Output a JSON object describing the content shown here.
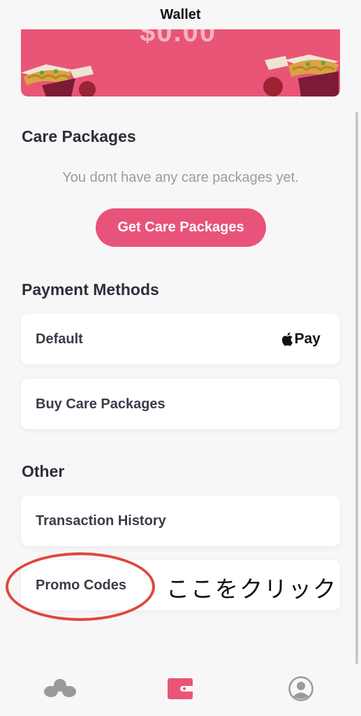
{
  "header": {
    "title": "Wallet"
  },
  "promo_card": {
    "partial_amount": "$0.00",
    "brand_color": "#e85577"
  },
  "care_packages": {
    "title": "Care Packages",
    "empty_message": "You dont have any care packages yet.",
    "cta_label": "Get Care Packages"
  },
  "payment_methods": {
    "title": "Payment Methods",
    "items": [
      {
        "label": "Default",
        "method": "Pay",
        "method_icon": "apple-icon"
      },
      {
        "label": "Buy Care Packages"
      }
    ]
  },
  "other": {
    "title": "Other",
    "items": [
      {
        "label": "Transaction History"
      },
      {
        "label": "Promo Codes"
      }
    ]
  },
  "annotation": {
    "text": "ここをクリック",
    "color": "#e0473c"
  },
  "tabbar": {
    "items": [
      {
        "icon": "home-icon",
        "active": false
      },
      {
        "icon": "wallet-icon",
        "active": true
      },
      {
        "icon": "profile-icon",
        "active": false
      }
    ],
    "active_color": "#e85577",
    "inactive_color": "#9a9a9a"
  }
}
